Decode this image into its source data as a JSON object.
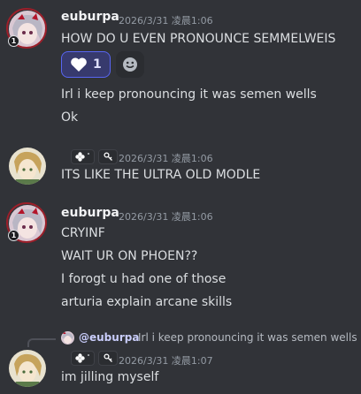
{
  "messages": [
    {
      "author": "euburpa",
      "timestamp": "2026/3/31 凌晨1:06",
      "badge": "1",
      "lines": [
        "HOW DO U EVEN PRONOUNCE SEMMELWEIS"
      ],
      "reaction": {
        "emoji": "heart",
        "count": "1"
      }
    },
    {
      "lines": [
        "Irl i keep pronouncing it was semen wells",
        "Ok"
      ]
    },
    {
      "timestamp": "2026/3/31 凌晨1:06",
      "lines": [
        "ITS LIKE THE ULTRA OLD MODLE"
      ]
    },
    {
      "author": "euburpa",
      "timestamp": "2026/3/31 凌晨1:06",
      "badge": "1",
      "lines": [
        "CRYINF",
        "WAIT UR ON PHOEN??",
        "I forogt u had one of those",
        "arturia explain arcane skills"
      ]
    },
    {
      "reply": {
        "author": "@euburpa",
        "text": "Irl i keep pronouncing it was semen wells"
      },
      "timestamp": "2026/3/31 凌晨1:07",
      "lines": [
        "im jilling myself"
      ]
    }
  ],
  "icons": {
    "reaction": "heart-icon",
    "add_reaction": "smiley-icon",
    "tag_flower": "flower-icon",
    "tag_key": "key-icon"
  },
  "colors": {
    "background": "#313338",
    "reaction_active": "#373a6d",
    "reaction_border": "#5865f2",
    "mention": "#c9cdfb"
  }
}
